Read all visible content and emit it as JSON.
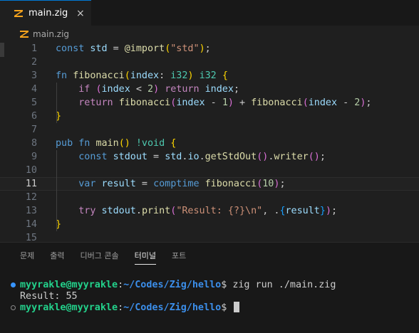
{
  "colors": {
    "keyword": "#569cd6",
    "function": "#dcdcaa",
    "string": "#ce9178",
    "variable": "#9cdcfe",
    "builtin": "#dcdcaa",
    "control": "#c586c0",
    "type": "#4ec9b0",
    "number": "#b5cea8",
    "bracket_gold": "#ffd700",
    "bracket_purple": "#da70d6",
    "bracket_blue": "#179fff",
    "terminal_green": "#23d18b",
    "terminal_blue": "#3b8eea",
    "tab_accent": "#0078d4"
  },
  "editor": {
    "tab": {
      "title": "main.zig",
      "close": "×",
      "icon": "zig-icon"
    },
    "breadcrumb": {
      "label": "main.zig",
      "icon": "zig-icon"
    },
    "current_line": 11,
    "lines": [
      {
        "n": "1",
        "tokens": [
          [
            "const",
            "keyword"
          ],
          [
            " ",
            "plain"
          ],
          [
            "std",
            "variable"
          ],
          [
            " = ",
            "plain"
          ],
          [
            "@import",
            "builtin"
          ],
          [
            "(",
            "bracket_gold"
          ],
          [
            "\"std\"",
            "string"
          ],
          [
            ")",
            "bracket_gold"
          ],
          [
            ";",
            "plain"
          ]
        ]
      },
      {
        "n": "2",
        "tokens": []
      },
      {
        "n": "3",
        "tokens": [
          [
            "fn",
            "keyword"
          ],
          [
            " ",
            "plain"
          ],
          [
            "fibonacci",
            "function"
          ],
          [
            "(",
            "bracket_gold"
          ],
          [
            "index",
            "variable"
          ],
          [
            ": ",
            "plain"
          ],
          [
            "i32",
            "type"
          ],
          [
            ")",
            "bracket_gold"
          ],
          [
            " ",
            "plain"
          ],
          [
            "i32",
            "type"
          ],
          [
            " ",
            "plain"
          ],
          [
            "{",
            "bracket_gold"
          ]
        ]
      },
      {
        "n": "4",
        "tokens": [
          [
            "    ",
            "plain"
          ],
          [
            "if",
            "control"
          ],
          [
            " ",
            "plain"
          ],
          [
            "(",
            "bracket_purple"
          ],
          [
            "index",
            "variable"
          ],
          [
            " < ",
            "plain"
          ],
          [
            "2",
            "number"
          ],
          [
            ")",
            "bracket_purple"
          ],
          [
            " ",
            "plain"
          ],
          [
            "return",
            "control"
          ],
          [
            " ",
            "plain"
          ],
          [
            "index",
            "variable"
          ],
          [
            ";",
            "plain"
          ]
        ]
      },
      {
        "n": "5",
        "tokens": [
          [
            "    ",
            "plain"
          ],
          [
            "return",
            "control"
          ],
          [
            " ",
            "plain"
          ],
          [
            "fibonacci",
            "function"
          ],
          [
            "(",
            "bracket_purple"
          ],
          [
            "index",
            "variable"
          ],
          [
            " - ",
            "plain"
          ],
          [
            "1",
            "number"
          ],
          [
            ")",
            "bracket_purple"
          ],
          [
            " + ",
            "plain"
          ],
          [
            "fibonacci",
            "function"
          ],
          [
            "(",
            "bracket_purple"
          ],
          [
            "index",
            "variable"
          ],
          [
            " - ",
            "plain"
          ],
          [
            "2",
            "number"
          ],
          [
            ")",
            "bracket_purple"
          ],
          [
            ";",
            "plain"
          ]
        ]
      },
      {
        "n": "6",
        "tokens": [
          [
            "}",
            "bracket_gold"
          ]
        ]
      },
      {
        "n": "7",
        "tokens": []
      },
      {
        "n": "8",
        "tokens": [
          [
            "pub",
            "keyword"
          ],
          [
            " ",
            "plain"
          ],
          [
            "fn",
            "keyword"
          ],
          [
            " ",
            "plain"
          ],
          [
            "main",
            "function"
          ],
          [
            "()",
            "bracket_gold"
          ],
          [
            " ",
            "plain"
          ],
          [
            "!void",
            "type"
          ],
          [
            " ",
            "plain"
          ],
          [
            "{",
            "bracket_gold"
          ]
        ]
      },
      {
        "n": "9",
        "tokens": [
          [
            "    ",
            "plain"
          ],
          [
            "const",
            "keyword"
          ],
          [
            " ",
            "plain"
          ],
          [
            "stdout",
            "variable"
          ],
          [
            " = ",
            "plain"
          ],
          [
            "std",
            "variable"
          ],
          [
            ".",
            "plain"
          ],
          [
            "io",
            "variable"
          ],
          [
            ".",
            "plain"
          ],
          [
            "getStdOut",
            "function"
          ],
          [
            "()",
            "bracket_purple"
          ],
          [
            ".",
            "plain"
          ],
          [
            "writer",
            "function"
          ],
          [
            "()",
            "bracket_purple"
          ],
          [
            ";",
            "plain"
          ]
        ]
      },
      {
        "n": "10",
        "tokens": []
      },
      {
        "n": "11",
        "tokens": [
          [
            "    ",
            "plain"
          ],
          [
            "var",
            "keyword"
          ],
          [
            " ",
            "plain"
          ],
          [
            "result",
            "variable"
          ],
          [
            " = ",
            "plain"
          ],
          [
            "comptime",
            "keyword"
          ],
          [
            " ",
            "plain"
          ],
          [
            "fibonacci",
            "function"
          ],
          [
            "(",
            "bracket_purple"
          ],
          [
            "10",
            "number"
          ],
          [
            ")",
            "bracket_purple"
          ],
          [
            ";",
            "plain"
          ]
        ]
      },
      {
        "n": "12",
        "tokens": []
      },
      {
        "n": "13",
        "tokens": [
          [
            "    ",
            "plain"
          ],
          [
            "try",
            "control"
          ],
          [
            " ",
            "plain"
          ],
          [
            "stdout",
            "variable"
          ],
          [
            ".",
            "plain"
          ],
          [
            "print",
            "function"
          ],
          [
            "(",
            "bracket_purple"
          ],
          [
            "\"Result: {?}\\n\"",
            "string"
          ],
          [
            ", .",
            "plain"
          ],
          [
            "{",
            "bracket_blue"
          ],
          [
            "result",
            "variable"
          ],
          [
            "}",
            "bracket_blue"
          ],
          [
            ")",
            "bracket_purple"
          ],
          [
            ";",
            "plain"
          ]
        ]
      },
      {
        "n": "14",
        "tokens": [
          [
            "}",
            "bracket_gold"
          ]
        ]
      },
      {
        "n": "15",
        "tokens": []
      }
    ]
  },
  "panel": {
    "tabs": [
      "문제",
      "출력",
      "디버그 콘솔",
      "터미널",
      "포트"
    ],
    "active_tab": "터미널"
  },
  "terminal": {
    "lines": [
      {
        "marker": "filled",
        "user": "myyrakle@myyrakle",
        "sep": ":",
        "path": "~/Codes/Zig/hello",
        "prompt": "$ ",
        "command": "zig run ./main.zig"
      },
      {
        "marker": "none",
        "output": "Result: 55"
      },
      {
        "marker": "empty",
        "user": "myyrakle@myyrakle",
        "sep": ":",
        "path": "~/Codes/Zig/hello",
        "prompt": "$ ",
        "command": "",
        "cursor": true
      }
    ]
  }
}
